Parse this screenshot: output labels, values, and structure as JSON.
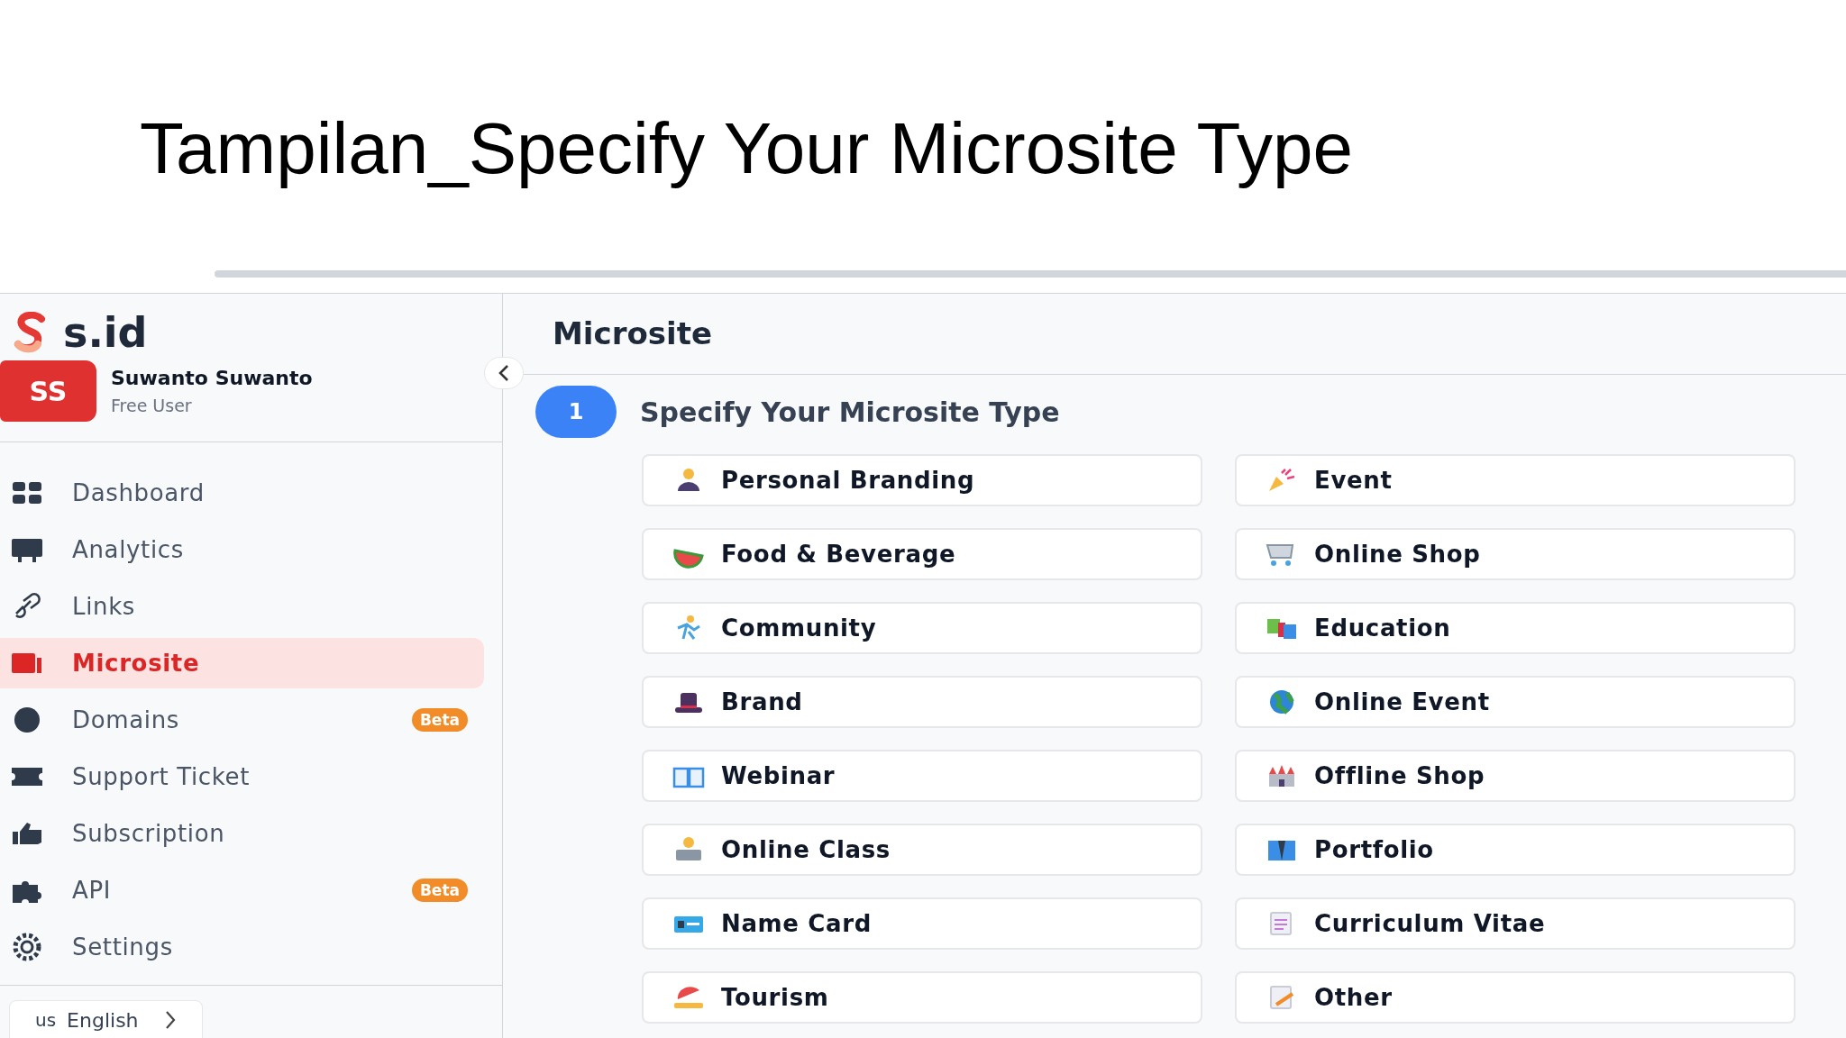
{
  "slide_title": "Tampilan_Specify Your Microsite Type",
  "sidebar": {
    "logo_text": "s.id",
    "user": {
      "initials": "SS",
      "name": "Suwanto Suwanto",
      "plan": "Free User"
    },
    "nav": [
      {
        "label": "Dashboard",
        "selected": false
      },
      {
        "label": "Analytics",
        "selected": false
      },
      {
        "label": "Links",
        "selected": false
      },
      {
        "label": "Microsite",
        "selected": true
      },
      {
        "label": "Domains",
        "selected": false,
        "badge": "Beta"
      },
      {
        "label": "Support Ticket",
        "selected": false
      },
      {
        "label": "Subscription",
        "selected": false
      },
      {
        "label": "API",
        "selected": false,
        "badge": "Beta"
      },
      {
        "label": "Settings",
        "selected": false
      }
    ],
    "language": {
      "flag": "us",
      "label": "English"
    }
  },
  "main": {
    "header": "Microsite",
    "step": {
      "number": "1",
      "title": "Specify Your Microsite Type"
    },
    "types": [
      "Personal Branding",
      "Event",
      "Food & Beverage",
      "Online Shop",
      "Community",
      "Education",
      "Brand",
      "Online Event",
      "Webinar",
      "Offline Shop",
      "Online Class",
      "Portfolio",
      "Name Card",
      "Curriculum Vitae",
      "Tourism",
      "Other"
    ]
  }
}
